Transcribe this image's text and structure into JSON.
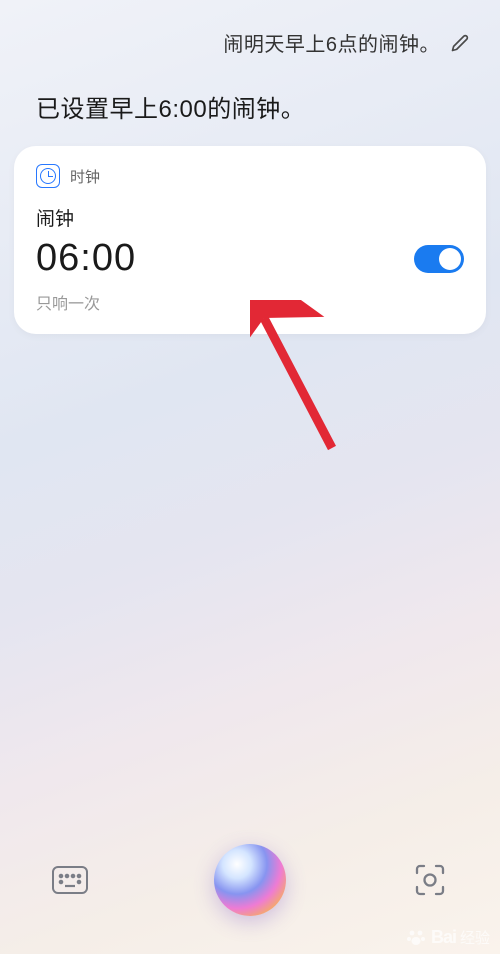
{
  "top": {
    "command": "闹明天早上6点的闹钟。"
  },
  "confirmation": "已设置早上6:00的闹钟。",
  "card": {
    "app_name": "时钟",
    "alarm_label": "闹钟",
    "time": "06:00",
    "repeat": "只响一次",
    "toggle_on": true
  },
  "watermark": {
    "logo": "Bai",
    "text": "经验"
  }
}
